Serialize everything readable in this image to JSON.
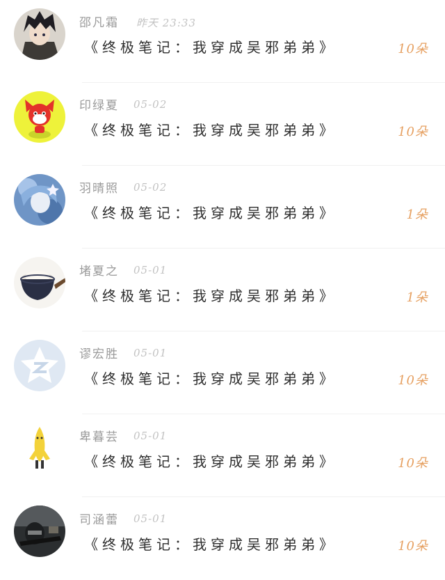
{
  "gifts": [
    {
      "name": "邵凡霜",
      "time": "昨天 23:33",
      "title": "《终极笔记：我穿成吴邪弟弟》",
      "count": "10朵",
      "avatar": "anime-boy-avatar"
    },
    {
      "name": "印绿夏",
      "time": "05-02",
      "title": "《终极笔记：我穿成吴邪弟弟》",
      "count": "10朵",
      "avatar": "red-fox-avatar"
    },
    {
      "name": "羽晴照",
      "time": "05-02",
      "title": "《终极笔记：我穿成吴邪弟弟》",
      "count": "1朵",
      "avatar": "blue-hair-girl-avatar"
    },
    {
      "name": "堵夏之",
      "time": "05-01",
      "title": "《终极笔记：我穿成吴邪弟弟》",
      "count": "1朵",
      "avatar": "rice-bowl-avatar"
    },
    {
      "name": "谬宏胜",
      "time": "05-01",
      "title": "《终极笔记：我穿成吴邪弟弟》",
      "count": "10朵",
      "avatar": "qzone-star-avatar"
    },
    {
      "name": "卑暮芸",
      "time": "05-01",
      "title": "《终极笔记：我穿成吴邪弟弟》",
      "count": "10朵",
      "avatar": "banana-man-avatar"
    },
    {
      "name": "司涵蕾",
      "time": "05-01",
      "title": "《终极笔记：我穿成吴邪弟弟》",
      "count": "10朵",
      "avatar": "soldier-avatar"
    }
  ],
  "colors": {
    "count": "#e6a061",
    "name": "#9a9a9a",
    "time": "#c2c2c2",
    "title": "#2e2e2e"
  }
}
